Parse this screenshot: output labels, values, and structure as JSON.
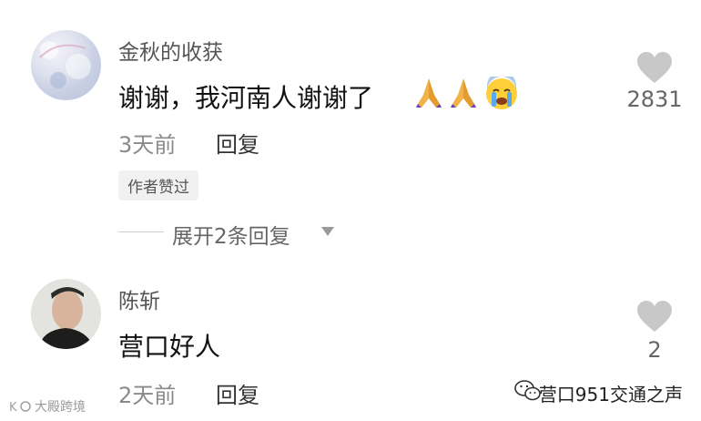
{
  "comments": [
    {
      "username": "金秋的收获",
      "text": "谢谢，我河南人谢谢了",
      "emojis": [
        "folded-hands",
        "folded-hands",
        "crying-face"
      ],
      "time": "3天前",
      "reply_label": "回复",
      "badge": "作者赞过",
      "likes": "2831",
      "expand_replies": "展开2条回复"
    },
    {
      "username": "陈斩",
      "text": "营口好人",
      "time": "2天前",
      "reply_label": "回复",
      "likes": "2"
    }
  ],
  "watermarks": {
    "left": "大殿跨境",
    "right": "营口951交通之声"
  },
  "colors": {
    "heart": "#c8c8c8",
    "badge_bg": "#f1f1f1",
    "muted_text": "#8a8a8a"
  }
}
